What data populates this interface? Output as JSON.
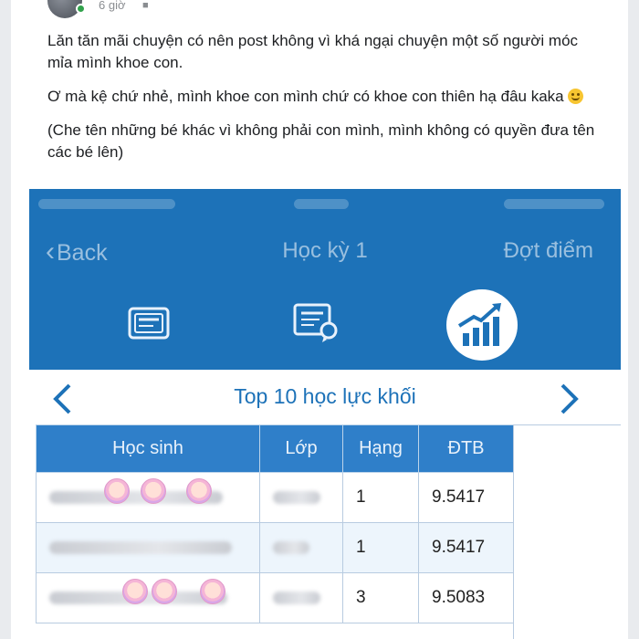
{
  "post": {
    "time": "6 giờ",
    "paragraphs": [
      "Lăn tăn mãi chuyện có nên post không vì khá ngại chuyện một số người móc mỉa mình khoe con.",
      "Ơ mà kệ chứ nhẻ, mình khoe con mình chứ có khoe con thiên hạ đâu kaka",
      "(Che tên những bé khác vì không phải con mình, mình không có quyền đưa tên các bé lên)"
    ]
  },
  "screenshot": {
    "nav": {
      "back_label": "Back",
      "title": "Học kỳ 1",
      "right_label": "Đợt điểm"
    },
    "section_title": "Top 10 học lực khối",
    "columns": [
      "Học sinh",
      "Lớp",
      "Hạng",
      "ĐTB"
    ],
    "rows": [
      {
        "rank": "1",
        "score": "9.5417"
      },
      {
        "rank": "1",
        "score": "9.5417"
      },
      {
        "rank": "3",
        "score": "9.5083"
      }
    ],
    "colors": {
      "primary": "#1d72b8",
      "header": "#2f7fc9",
      "row_alt": "#edf5fc"
    }
  }
}
